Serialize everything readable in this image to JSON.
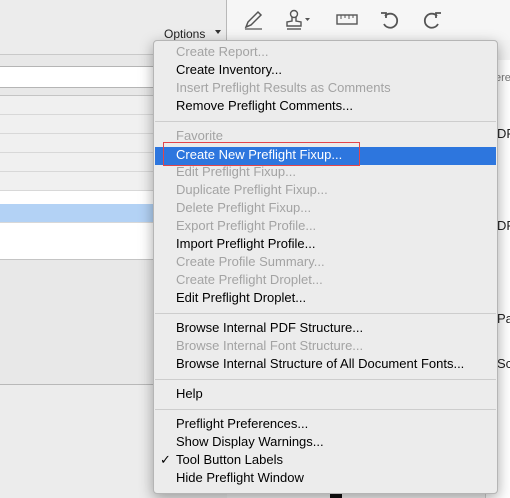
{
  "left_panel": {
    "options_label": "Options"
  },
  "toolbar": {
    "icons": [
      "pencil-icon",
      "stamp-icon",
      "measure-icon",
      "undo-icon",
      "redo-icon"
    ]
  },
  "document_fragments": [
    "ere",
    "DF",
    "DF",
    "Pa",
    "Sc"
  ],
  "menu": {
    "group1": [
      {
        "label": "Create Report...",
        "enabled": false
      },
      {
        "label": "Create Inventory...",
        "enabled": true
      },
      {
        "label": "Insert Preflight Results as Comments",
        "enabled": false
      },
      {
        "label": "Remove Preflight Comments...",
        "enabled": true
      }
    ],
    "group2": [
      {
        "label": "Favorite",
        "enabled": false
      },
      {
        "label": "Create New Preflight Fixup...",
        "enabled": true,
        "highlighted": true
      },
      {
        "label": "Edit Preflight Fixup...",
        "enabled": false
      },
      {
        "label": "Duplicate Preflight Fixup...",
        "enabled": false
      },
      {
        "label": "Delete Preflight Fixup...",
        "enabled": false
      },
      {
        "label": "Export Preflight Profile...",
        "enabled": false
      },
      {
        "label": "Import Preflight Profile...",
        "enabled": true
      },
      {
        "label": "Create Profile Summary...",
        "enabled": false
      },
      {
        "label": "Create Preflight Droplet...",
        "enabled": false
      },
      {
        "label": "Edit Preflight Droplet...",
        "enabled": true
      }
    ],
    "group3": [
      {
        "label": "Browse Internal PDF Structure...",
        "enabled": true
      },
      {
        "label": "Browse Internal Font Structure...",
        "enabled": false
      },
      {
        "label": "Browse Internal Structure of All Document Fonts...",
        "enabled": true
      }
    ],
    "group4": [
      {
        "label": "Help",
        "enabled": true
      }
    ],
    "group5": [
      {
        "label": "Preflight Preferences...",
        "enabled": true
      },
      {
        "label": "Show Display Warnings...",
        "enabled": true
      },
      {
        "label": "Tool Button Labels",
        "enabled": true,
        "checked": true
      },
      {
        "label": "Hide Preflight Window",
        "enabled": true
      }
    ],
    "check_mark": "✓",
    "colors": {
      "highlight": "#2d76de",
      "disabled_text": "#a3a3a3",
      "callout_border": "#e3454a"
    }
  }
}
